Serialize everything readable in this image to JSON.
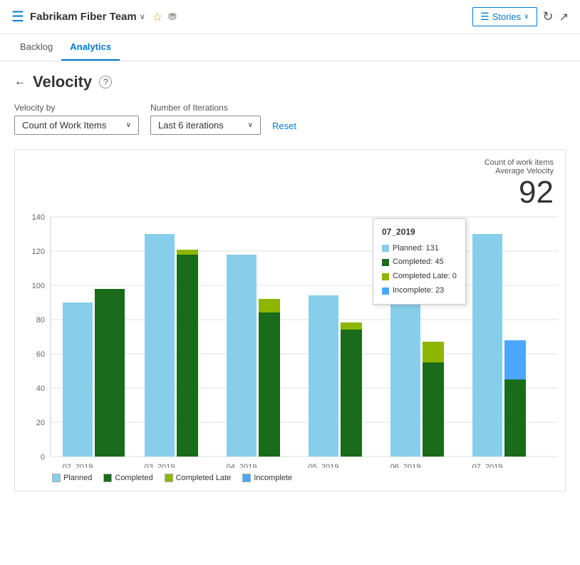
{
  "header": {
    "icon": "☰",
    "title": "Fabrikam Fiber Team",
    "chevron": "∨",
    "star": "☆",
    "people": "👥",
    "stories_label": "Stories",
    "stories_chevron": "∨",
    "refresh_icon": "↻",
    "expand_icon": "⤢"
  },
  "nav": {
    "tabs": [
      {
        "label": "Backlog",
        "active": false
      },
      {
        "label": "Analytics",
        "active": true
      }
    ]
  },
  "page": {
    "back_icon": "←",
    "title": "Velocity",
    "help_icon": "?",
    "velocity_by_label": "Velocity by",
    "velocity_by_value": "Count of Work Items",
    "iterations_label": "Number of Iterations",
    "iterations_value": "Last 6 iterations",
    "reset_label": "Reset"
  },
  "summary": {
    "label_line1": "Count of work items",
    "label_line2": "Average Velocity",
    "value": "92"
  },
  "chart": {
    "y_labels": [
      "0",
      "20",
      "40",
      "60",
      "80",
      "100",
      "120",
      "140"
    ],
    "x_labels": [
      "02_2019",
      "03_2019",
      "04_2019",
      "05_2019",
      "06_2019",
      "07_2019"
    ],
    "bars": [
      {
        "sprint": "02_2019",
        "planned": 90,
        "completed": 98,
        "completed_late": 0,
        "incomplete": 0
      },
      {
        "sprint": "03_2019",
        "planned": 130,
        "completed": 118,
        "completed_late": 0,
        "incomplete": 0
      },
      {
        "sprint": "04_2019",
        "planned": 118,
        "completed": 84,
        "completed_late": 8,
        "incomplete": 0
      },
      {
        "sprint": "05_2019",
        "planned": 94,
        "completed": 74,
        "completed_late": 4,
        "incomplete": 0
      },
      {
        "sprint": "06_2019",
        "planned": 91,
        "completed": 55,
        "completed_late": 12,
        "incomplete": 0
      },
      {
        "sprint": "07_2019",
        "planned": 130,
        "completed": 45,
        "completed_late": 0,
        "incomplete": 23
      }
    ],
    "tooltip": {
      "title": "07_2019",
      "planned_label": "Planned:",
      "planned_value": "131",
      "completed_label": "Completed:",
      "completed_value": "45",
      "completed_late_label": "Completed Late:",
      "completed_late_value": "0",
      "incomplete_label": "Incomplete:",
      "incomplete_value": "23"
    }
  },
  "legend": {
    "items": [
      {
        "label": "Planned",
        "color": "#add8e6"
      },
      {
        "label": "Completed",
        "color": "#1a6b1a"
      },
      {
        "label": "Completed Late",
        "color": "#8db600"
      },
      {
        "label": "Incomplete",
        "color": "#0078d4"
      }
    ]
  },
  "colors": {
    "planned": "#87ceeb",
    "completed": "#1a6b1a",
    "completed_late": "#8db600",
    "incomplete": "#4da6ff",
    "accent": "#0078d4"
  }
}
